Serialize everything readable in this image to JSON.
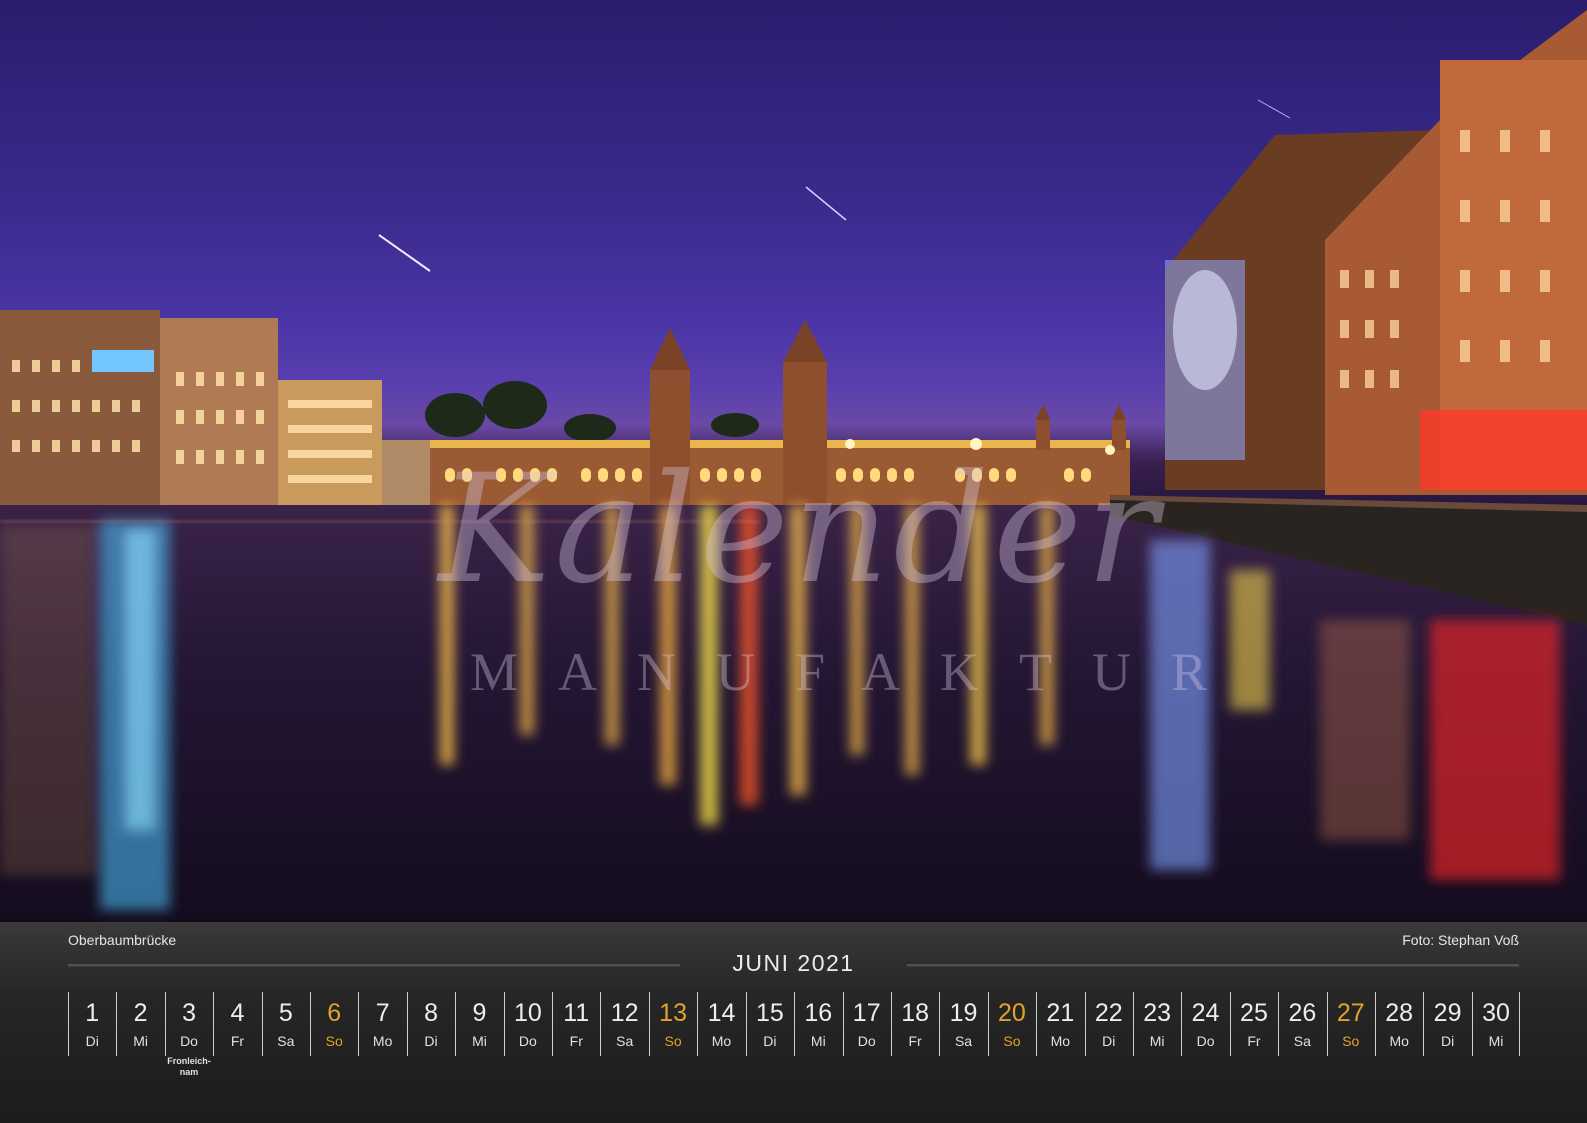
{
  "photo": {
    "caption": "Oberbaumbrücke",
    "credit": "Foto: Stephan Voß",
    "watermark_script": "Kalender",
    "watermark_sub": "MANUFAKTUR"
  },
  "calendar": {
    "month_title": "JUNI 2021",
    "accent_color": "#e3a22a",
    "days": [
      {
        "num": "1",
        "name": "Di",
        "note": "",
        "sunday": false
      },
      {
        "num": "2",
        "name": "Mi",
        "note": "",
        "sunday": false
      },
      {
        "num": "3",
        "name": "Do",
        "note": "Fronleich-\nnam",
        "sunday": false
      },
      {
        "num": "4",
        "name": "Fr",
        "note": "",
        "sunday": false
      },
      {
        "num": "5",
        "name": "Sa",
        "note": "",
        "sunday": false
      },
      {
        "num": "6",
        "name": "So",
        "note": "",
        "sunday": true
      },
      {
        "num": "7",
        "name": "Mo",
        "note": "",
        "sunday": false
      },
      {
        "num": "8",
        "name": "Di",
        "note": "",
        "sunday": false
      },
      {
        "num": "9",
        "name": "Mi",
        "note": "",
        "sunday": false
      },
      {
        "num": "10",
        "name": "Do",
        "note": "",
        "sunday": false
      },
      {
        "num": "11",
        "name": "Fr",
        "note": "",
        "sunday": false
      },
      {
        "num": "12",
        "name": "Sa",
        "note": "",
        "sunday": false
      },
      {
        "num": "13",
        "name": "So",
        "note": "",
        "sunday": true
      },
      {
        "num": "14",
        "name": "Mo",
        "note": "",
        "sunday": false
      },
      {
        "num": "15",
        "name": "Di",
        "note": "",
        "sunday": false
      },
      {
        "num": "16",
        "name": "Mi",
        "note": "",
        "sunday": false
      },
      {
        "num": "17",
        "name": "Do",
        "note": "",
        "sunday": false
      },
      {
        "num": "18",
        "name": "Fr",
        "note": "",
        "sunday": false
      },
      {
        "num": "19",
        "name": "Sa",
        "note": "",
        "sunday": false
      },
      {
        "num": "20",
        "name": "So",
        "note": "",
        "sunday": true
      },
      {
        "num": "21",
        "name": "Mo",
        "note": "",
        "sunday": false
      },
      {
        "num": "22",
        "name": "Di",
        "note": "",
        "sunday": false
      },
      {
        "num": "23",
        "name": "Mi",
        "note": "",
        "sunday": false
      },
      {
        "num": "24",
        "name": "Do",
        "note": "",
        "sunday": false
      },
      {
        "num": "25",
        "name": "Fr",
        "note": "",
        "sunday": false
      },
      {
        "num": "26",
        "name": "Sa",
        "note": "",
        "sunday": false
      },
      {
        "num": "27",
        "name": "So",
        "note": "",
        "sunday": true
      },
      {
        "num": "28",
        "name": "Mo",
        "note": "",
        "sunday": false
      },
      {
        "num": "29",
        "name": "Di",
        "note": "",
        "sunday": false
      },
      {
        "num": "30",
        "name": "Mi",
        "note": "",
        "sunday": false
      }
    ]
  }
}
